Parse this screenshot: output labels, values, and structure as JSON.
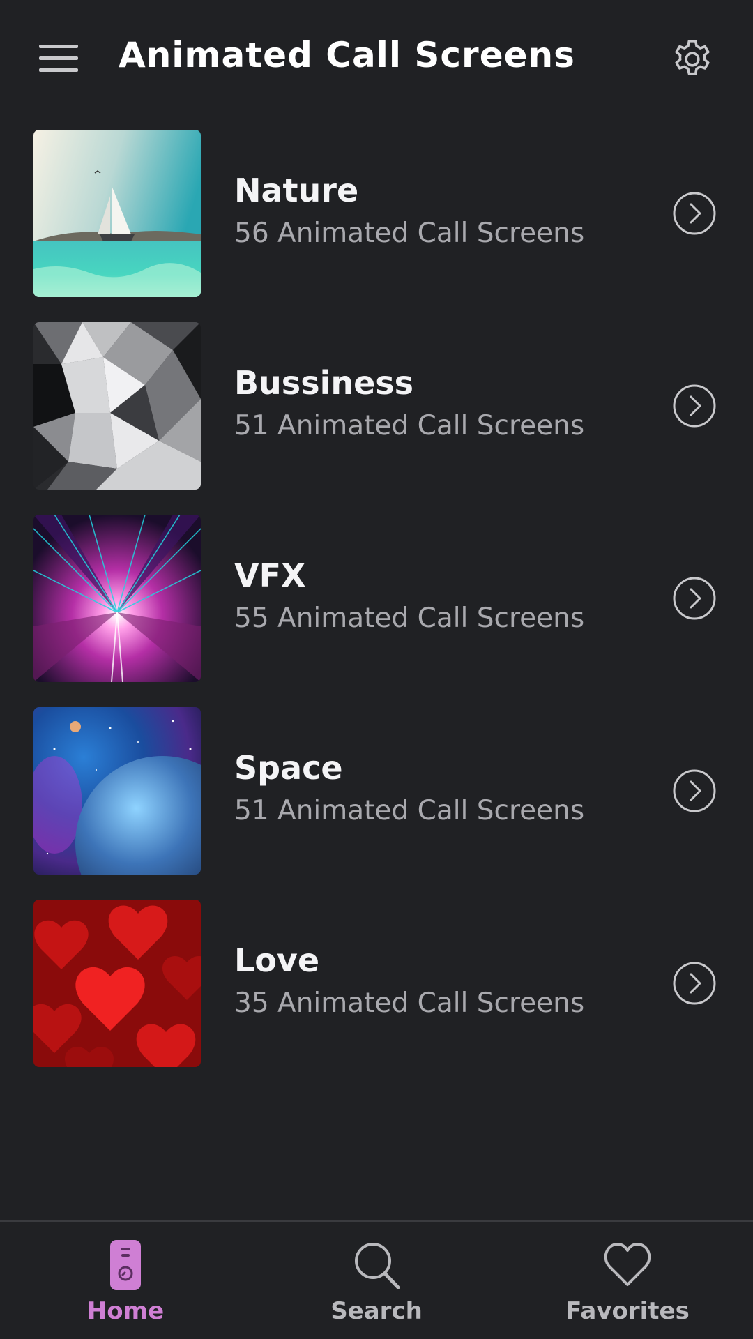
{
  "app": {
    "title": "Animated Call Screens"
  },
  "header": {
    "menu_icon": "hamburger-menu-icon",
    "settings_icon": "gear-icon"
  },
  "categories": [
    {
      "title": "Nature",
      "subtitle": "56 Animated Call Screens",
      "image": "sailboat-on-turquoise-sea",
      "arrow_icon": "chevron-right-circle-icon"
    },
    {
      "title": "Bussiness",
      "subtitle": "51 Animated Call Screens",
      "image": "silver-low-poly-geometric",
      "arrow_icon": "chevron-right-circle-icon"
    },
    {
      "title": "VFX",
      "subtitle": "55 Animated Call Screens",
      "image": "neon-pink-tunnel",
      "arrow_icon": "chevron-right-circle-icon"
    },
    {
      "title": "Space",
      "subtitle": "51 Animated Call Screens",
      "image": "blue-planet-nebula",
      "arrow_icon": "chevron-right-circle-icon"
    },
    {
      "title": "Love",
      "subtitle": "35 Animated Call Screens",
      "image": "red-hearts",
      "arrow_icon": "chevron-right-circle-icon"
    }
  ],
  "bottom_nav": {
    "items": [
      {
        "label": "Home",
        "icon": "phone-device-icon",
        "active": true
      },
      {
        "label": "Search",
        "icon": "search-icon",
        "active": false
      },
      {
        "label": "Favorites",
        "icon": "heart-icon",
        "active": false
      }
    ]
  },
  "colors": {
    "background": "#202124",
    "accent": "#cf7fd4",
    "text_primary": "#f4f4f6",
    "text_secondary": "#a9a9ae",
    "icon_gray": "#c9c9cc"
  }
}
